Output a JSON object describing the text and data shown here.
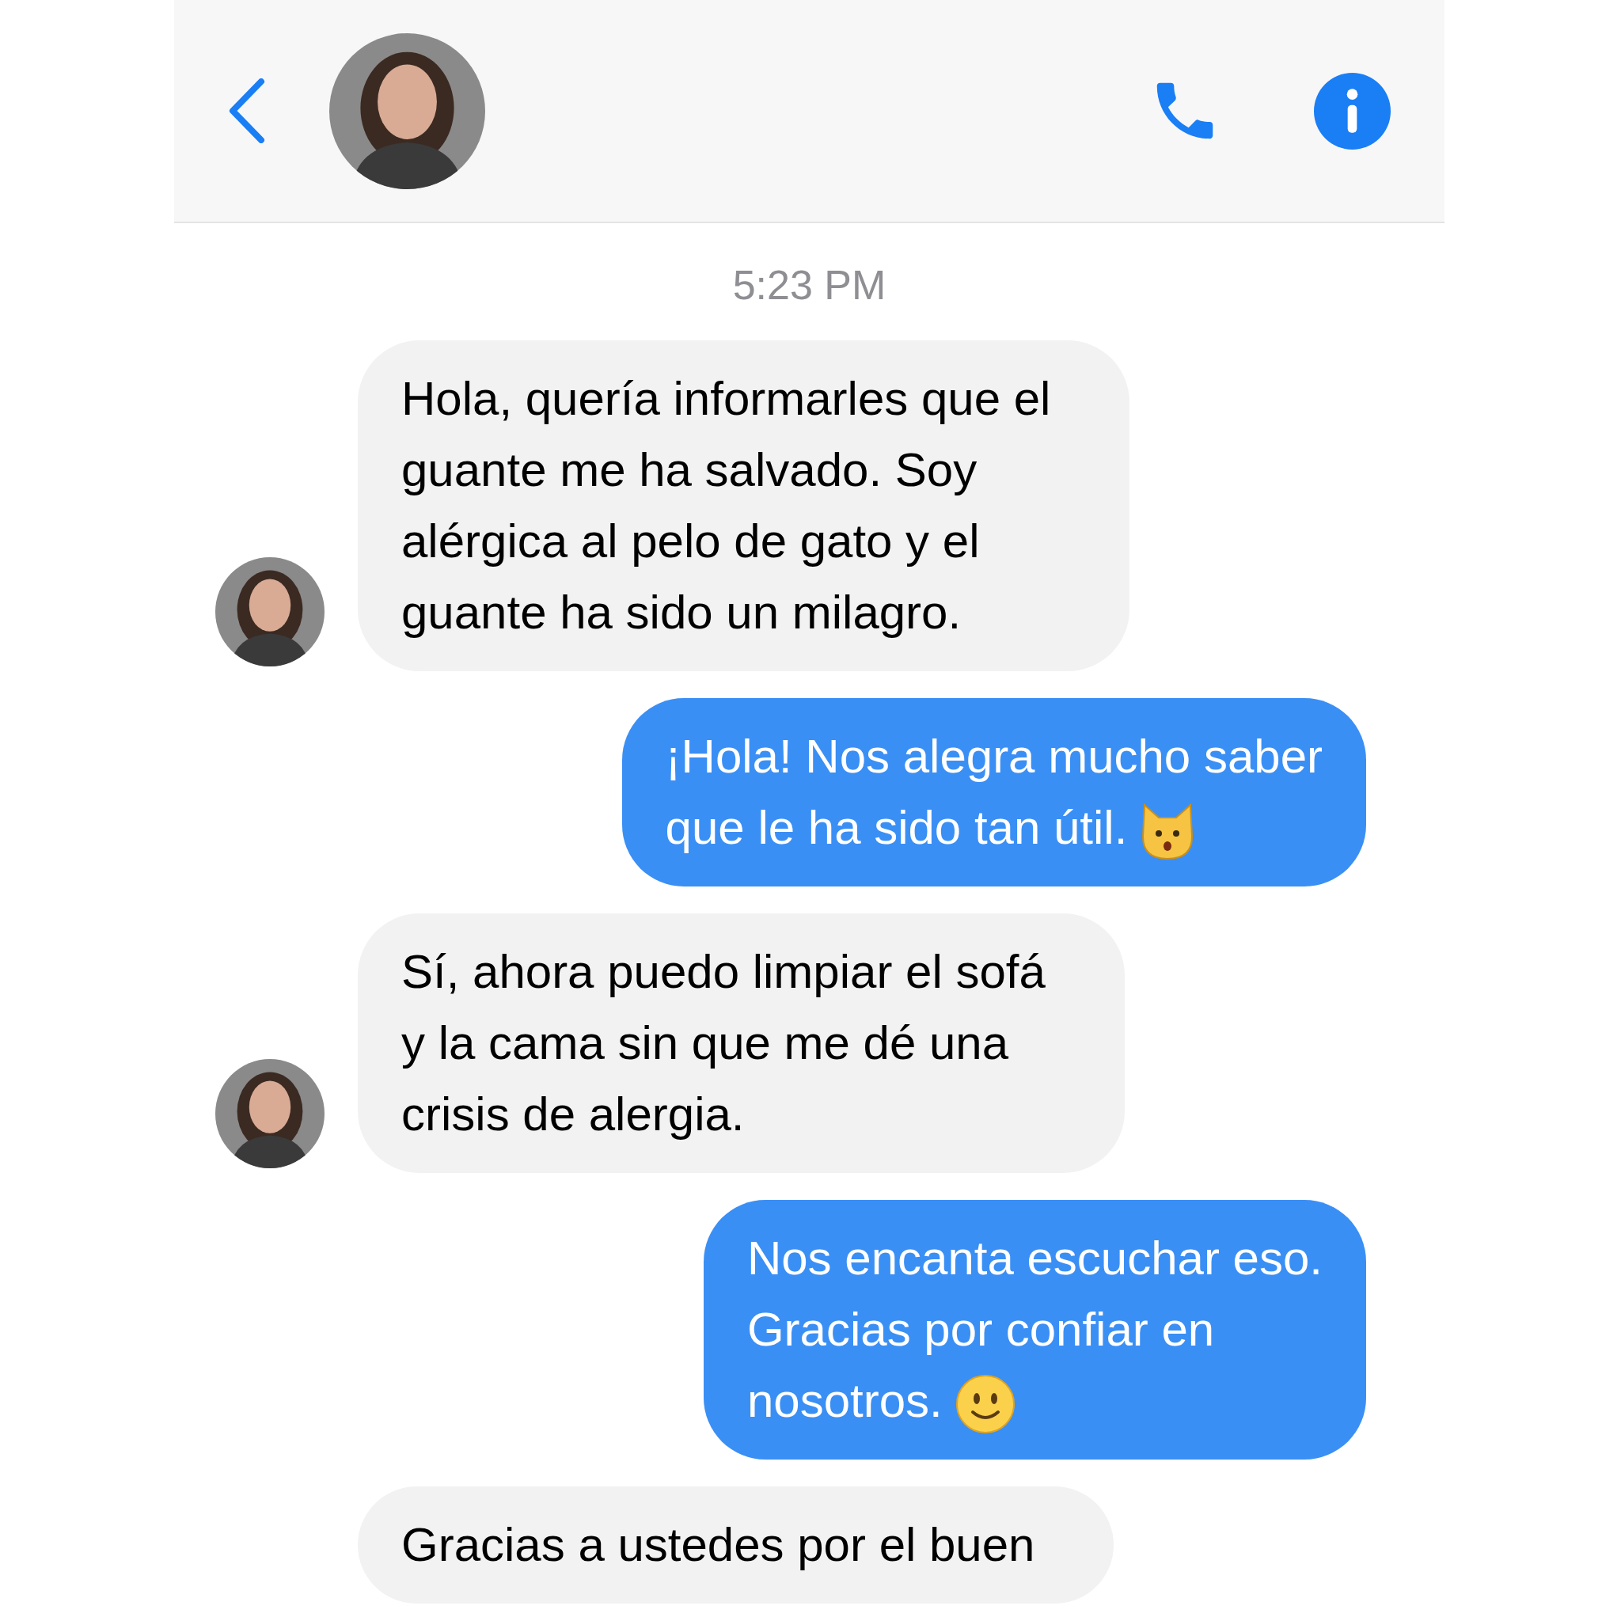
{
  "timestamp": "5:23 PM",
  "messages": [
    {
      "kind": "received",
      "avatar": true,
      "lines": [
        "Hola, quería informarles que el",
        "guante me ha salvado. Soy",
        "alérgica al pelo de gato y el",
        "guante ha sido un milagro."
      ]
    },
    {
      "kind": "sent",
      "emoji": {
        "kind": "cat"
      },
      "lines": [
        "¡Hola! Nos alegra mucho saber",
        "que le ha sido tan útil."
      ]
    },
    {
      "kind": "received",
      "avatar": true,
      "lines": [
        "Sí, ahora puedo limpiar el sofá",
        "y la cama sin que me dé una",
        "crisis de alergia."
      ]
    },
    {
      "kind": "sent",
      "emoji": {
        "kind": "smile"
      },
      "lines": [
        "Nos encanta escuchar eso.",
        "Gracias por confiar en",
        "nosotros."
      ]
    },
    {
      "kind": "received",
      "avatar": false,
      "lines": [
        "Gracias a ustedes por el buen"
      ]
    }
  ]
}
